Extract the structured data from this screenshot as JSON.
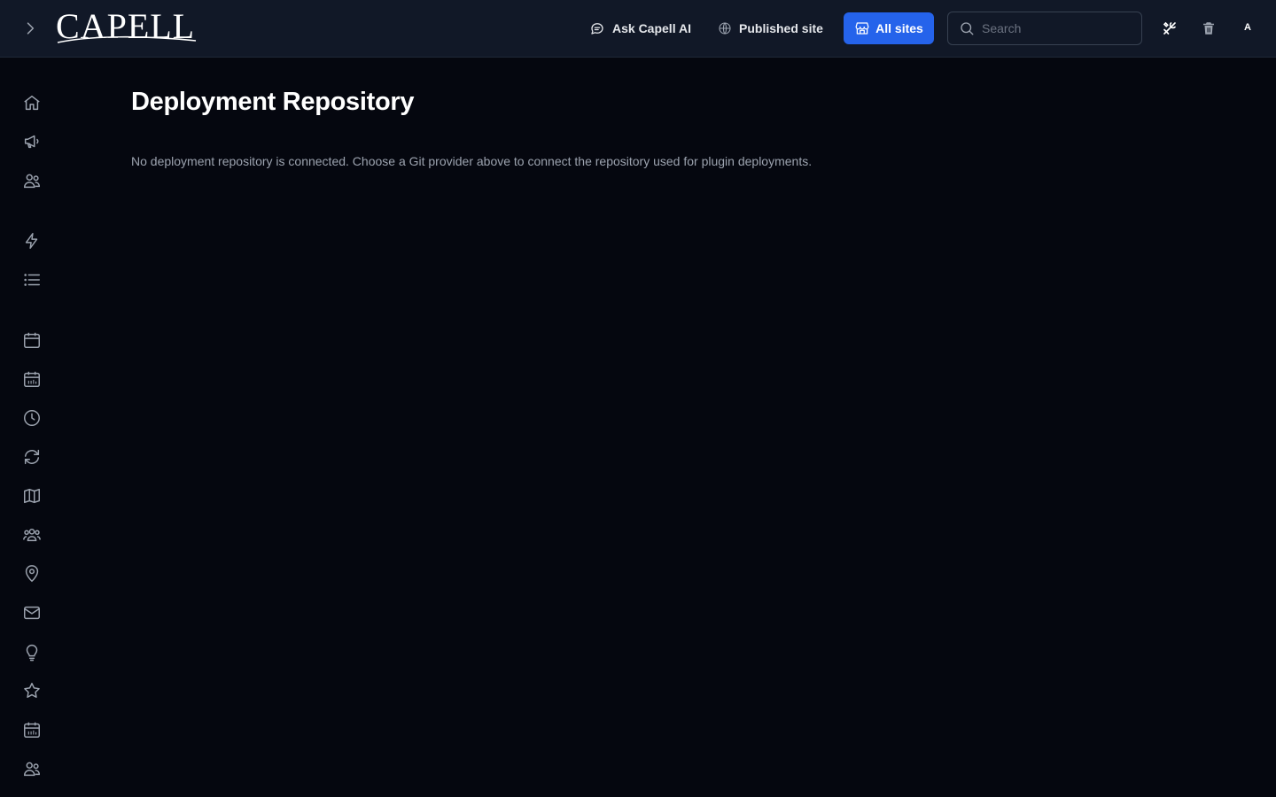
{
  "header": {
    "logo_text": "CAPELL",
    "ask_ai_label": "Ask Capell AI",
    "published_site_label": "Published site",
    "all_sites_label": "All sites",
    "search_placeholder": "Search",
    "avatar_initial": "A"
  },
  "sidebar": {
    "items": [
      {
        "icon": "home-icon"
      },
      {
        "icon": "megaphone-icon"
      },
      {
        "icon": "users-icon"
      },
      {
        "icon": "bolt-icon"
      },
      {
        "icon": "list-icon"
      },
      {
        "icon": "calendar-icon"
      },
      {
        "icon": "calendar-days-icon"
      },
      {
        "icon": "clock-icon"
      },
      {
        "icon": "refresh-icon"
      },
      {
        "icon": "map-icon"
      },
      {
        "icon": "user-group-icon"
      },
      {
        "icon": "map-pin-icon"
      },
      {
        "icon": "envelope-icon"
      },
      {
        "icon": "light-bulb-icon"
      },
      {
        "icon": "star-icon"
      },
      {
        "icon": "calendar-days-icon"
      },
      {
        "icon": "users-icon"
      }
    ]
  },
  "main": {
    "title": "Deployment Repository",
    "description": "No deployment repository is connected. Choose a Git provider above to connect the repository used for plugin deployments."
  },
  "colors": {
    "background": "#05070f",
    "topbar": "#111827",
    "accent": "#2563eb",
    "muted_text": "#9ca3af"
  }
}
